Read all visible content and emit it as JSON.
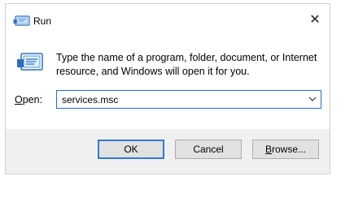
{
  "window": {
    "title": "Run",
    "title_icon": "run-icon",
    "close_symbol": "✕"
  },
  "body": {
    "icon": "run-icon",
    "message": "Type the name of a program, folder, document, or Internet resource, and Windows will open it for you."
  },
  "open_field": {
    "label_access_key": "O",
    "label_rest": "pen:",
    "value": "services.msc",
    "dropdown_icon": "chevron-down-icon"
  },
  "buttons": {
    "ok": "OK",
    "cancel": "Cancel",
    "browse_access_key": "B",
    "browse_rest": "rowse..."
  },
  "colors": {
    "accent": "#2f7bd6",
    "footer_bg": "#f0f0f0",
    "button_bg": "#e1e1e1"
  }
}
